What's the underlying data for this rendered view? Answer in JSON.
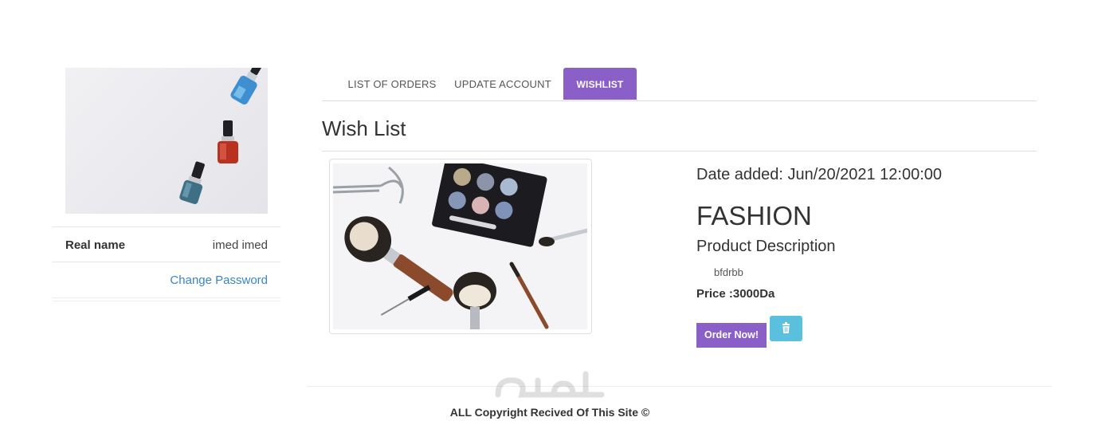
{
  "profile": {
    "photo_icon": "nail-polish-photo",
    "real_name_label": "Real name",
    "real_name_value": "imed imed",
    "change_password_label": "Change Password"
  },
  "tabs": [
    {
      "label": "LIST OF ORDERS",
      "active": false
    },
    {
      "label": "UPDATE ACCOUNT",
      "active": false
    },
    {
      "label": "WISHLIST",
      "active": true
    }
  ],
  "wishlist": {
    "title": "Wish List",
    "item": {
      "image_icon": "makeup-products-photo",
      "date_added": "Date added: Jun/20/2021 12:00:00",
      "category": "FASHION",
      "description_heading": "Product Description",
      "description": "bfdrbb",
      "price": "Price :3000Da",
      "order_button": "Order Now!",
      "delete_icon": "trash-icon"
    }
  },
  "footer": {
    "text": "ALL Copyright Recived Of This Site ©",
    "watermark_icon": "mostaql-watermark"
  },
  "colors": {
    "accent": "#8a5fc7",
    "info": "#5bc0de",
    "link": "#3a85c6"
  }
}
